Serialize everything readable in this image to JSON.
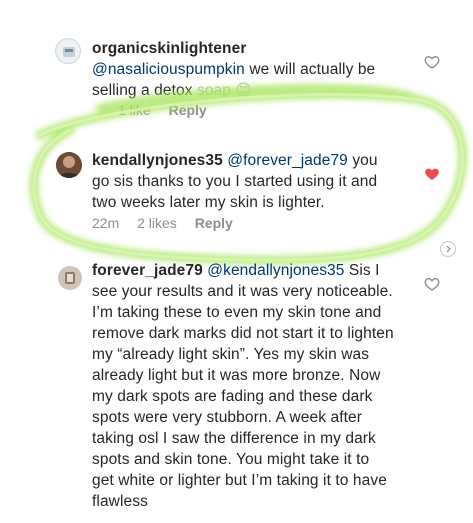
{
  "comments": [
    {
      "username": "organicskinlightener",
      "mention": "@nasaliciouspumpkin",
      "text": "we will actually be selling a detox",
      "text_line2_tail": "soap 😊",
      "likes": "1 like",
      "reply": "Reply",
      "liked": false
    },
    {
      "username": "kendallynjones35",
      "mention": "@forever_jade79",
      "text": "you go sis thanks to you I started using it and two weeks later my skin is lighter.",
      "time": "22m",
      "likes": "2 likes",
      "reply": "Reply",
      "liked": true
    },
    {
      "username": "forever_jade79",
      "mention": "@kendallynjones35",
      "text": "Sis I see your results and it was very noticeable. I’m taking these to even my skin tone and remove dark marks did not start it to lighten my “already light skin”. Yes my skin was already light but it was more bronze. Now my dark spots are fading and these dark spots were very stubborn. A week after taking osl I saw the difference in my dark spots and skin tone. You might take it to get white or lighter but I’m taking it to have flawless",
      "liked": false
    }
  ],
  "colors": {
    "highlight": "#a6e35a",
    "heart_liked": "#ed4956",
    "heart_outline": "#8e8e8e",
    "mention": "#00376b",
    "meta": "#8e8e8e"
  },
  "icons": {
    "heart": "heart-icon",
    "chevron": "chevron-right-icon"
  }
}
